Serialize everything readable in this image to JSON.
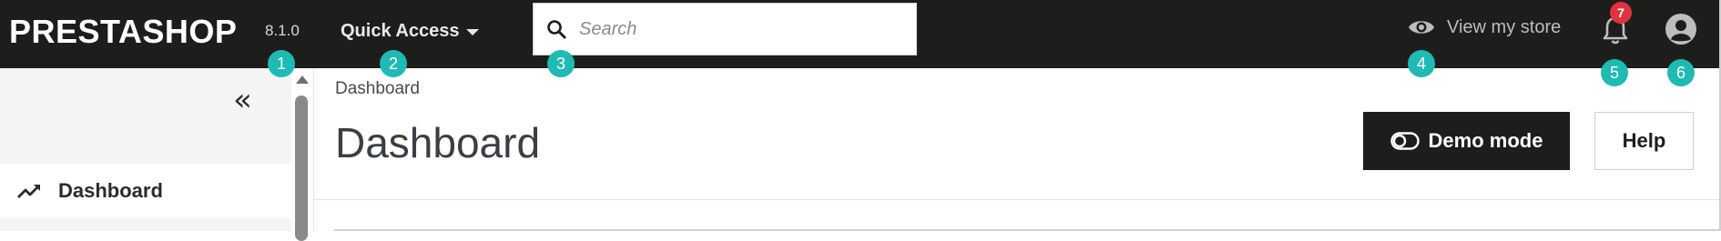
{
  "header": {
    "logo": "PRESTASHOP",
    "version": "8.1.0",
    "quick_access_label": "Quick Access",
    "search_placeholder": "Search",
    "view_store_label": "View my store",
    "notification_count": "7"
  },
  "markers": [
    "1",
    "2",
    "3",
    "4",
    "5",
    "6"
  ],
  "sidebar": {
    "collapse_glyph": "«",
    "items": [
      {
        "label": "Dashboard",
        "icon": "trending-up-icon"
      }
    ]
  },
  "main": {
    "breadcrumb": "Dashboard",
    "title": "Dashboard",
    "demo_mode_label": "Demo mode",
    "help_label": "Help"
  },
  "colors": {
    "topbar_bg": "#1d1d1b",
    "marker_bg": "#1fbab3",
    "badge_bg": "#e0323d"
  }
}
